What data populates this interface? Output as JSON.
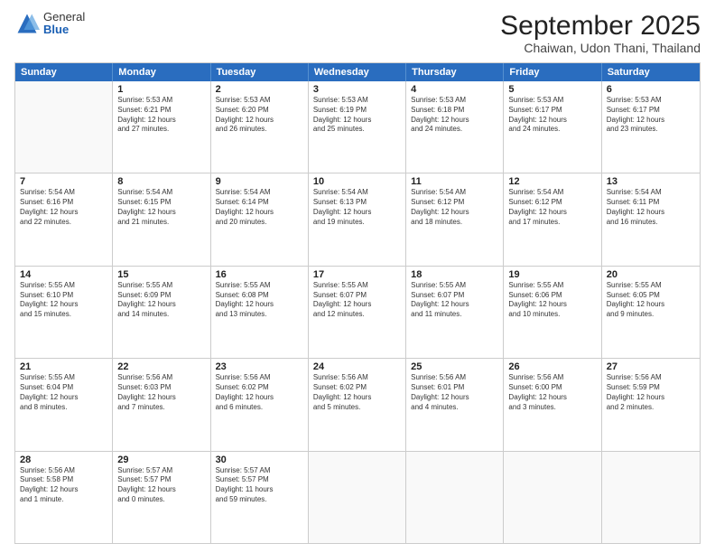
{
  "header": {
    "logo": {
      "general": "General",
      "blue": "Blue"
    },
    "title": "September 2025",
    "location": "Chaiwan, Udon Thani, Thailand"
  },
  "days_of_week": [
    "Sunday",
    "Monday",
    "Tuesday",
    "Wednesday",
    "Thursday",
    "Friday",
    "Saturday"
  ],
  "weeks": [
    [
      {
        "day": "",
        "info": ""
      },
      {
        "day": "1",
        "info": "Sunrise: 5:53 AM\nSunset: 6:21 PM\nDaylight: 12 hours\nand 27 minutes."
      },
      {
        "day": "2",
        "info": "Sunrise: 5:53 AM\nSunset: 6:20 PM\nDaylight: 12 hours\nand 26 minutes."
      },
      {
        "day": "3",
        "info": "Sunrise: 5:53 AM\nSunset: 6:19 PM\nDaylight: 12 hours\nand 25 minutes."
      },
      {
        "day": "4",
        "info": "Sunrise: 5:53 AM\nSunset: 6:18 PM\nDaylight: 12 hours\nand 24 minutes."
      },
      {
        "day": "5",
        "info": "Sunrise: 5:53 AM\nSunset: 6:17 PM\nDaylight: 12 hours\nand 24 minutes."
      },
      {
        "day": "6",
        "info": "Sunrise: 5:53 AM\nSunset: 6:17 PM\nDaylight: 12 hours\nand 23 minutes."
      }
    ],
    [
      {
        "day": "7",
        "info": "Sunrise: 5:54 AM\nSunset: 6:16 PM\nDaylight: 12 hours\nand 22 minutes."
      },
      {
        "day": "8",
        "info": "Sunrise: 5:54 AM\nSunset: 6:15 PM\nDaylight: 12 hours\nand 21 minutes."
      },
      {
        "day": "9",
        "info": "Sunrise: 5:54 AM\nSunset: 6:14 PM\nDaylight: 12 hours\nand 20 minutes."
      },
      {
        "day": "10",
        "info": "Sunrise: 5:54 AM\nSunset: 6:13 PM\nDaylight: 12 hours\nand 19 minutes."
      },
      {
        "day": "11",
        "info": "Sunrise: 5:54 AM\nSunset: 6:12 PM\nDaylight: 12 hours\nand 18 minutes."
      },
      {
        "day": "12",
        "info": "Sunrise: 5:54 AM\nSunset: 6:12 PM\nDaylight: 12 hours\nand 17 minutes."
      },
      {
        "day": "13",
        "info": "Sunrise: 5:54 AM\nSunset: 6:11 PM\nDaylight: 12 hours\nand 16 minutes."
      }
    ],
    [
      {
        "day": "14",
        "info": "Sunrise: 5:55 AM\nSunset: 6:10 PM\nDaylight: 12 hours\nand 15 minutes."
      },
      {
        "day": "15",
        "info": "Sunrise: 5:55 AM\nSunset: 6:09 PM\nDaylight: 12 hours\nand 14 minutes."
      },
      {
        "day": "16",
        "info": "Sunrise: 5:55 AM\nSunset: 6:08 PM\nDaylight: 12 hours\nand 13 minutes."
      },
      {
        "day": "17",
        "info": "Sunrise: 5:55 AM\nSunset: 6:07 PM\nDaylight: 12 hours\nand 12 minutes."
      },
      {
        "day": "18",
        "info": "Sunrise: 5:55 AM\nSunset: 6:07 PM\nDaylight: 12 hours\nand 11 minutes."
      },
      {
        "day": "19",
        "info": "Sunrise: 5:55 AM\nSunset: 6:06 PM\nDaylight: 12 hours\nand 10 minutes."
      },
      {
        "day": "20",
        "info": "Sunrise: 5:55 AM\nSunset: 6:05 PM\nDaylight: 12 hours\nand 9 minutes."
      }
    ],
    [
      {
        "day": "21",
        "info": "Sunrise: 5:55 AM\nSunset: 6:04 PM\nDaylight: 12 hours\nand 8 minutes."
      },
      {
        "day": "22",
        "info": "Sunrise: 5:56 AM\nSunset: 6:03 PM\nDaylight: 12 hours\nand 7 minutes."
      },
      {
        "day": "23",
        "info": "Sunrise: 5:56 AM\nSunset: 6:02 PM\nDaylight: 12 hours\nand 6 minutes."
      },
      {
        "day": "24",
        "info": "Sunrise: 5:56 AM\nSunset: 6:02 PM\nDaylight: 12 hours\nand 5 minutes."
      },
      {
        "day": "25",
        "info": "Sunrise: 5:56 AM\nSunset: 6:01 PM\nDaylight: 12 hours\nand 4 minutes."
      },
      {
        "day": "26",
        "info": "Sunrise: 5:56 AM\nSunset: 6:00 PM\nDaylight: 12 hours\nand 3 minutes."
      },
      {
        "day": "27",
        "info": "Sunrise: 5:56 AM\nSunset: 5:59 PM\nDaylight: 12 hours\nand 2 minutes."
      }
    ],
    [
      {
        "day": "28",
        "info": "Sunrise: 5:56 AM\nSunset: 5:58 PM\nDaylight: 12 hours\nand 1 minute."
      },
      {
        "day": "29",
        "info": "Sunrise: 5:57 AM\nSunset: 5:57 PM\nDaylight: 12 hours\nand 0 minutes."
      },
      {
        "day": "30",
        "info": "Sunrise: 5:57 AM\nSunset: 5:57 PM\nDaylight: 11 hours\nand 59 minutes."
      },
      {
        "day": "",
        "info": ""
      },
      {
        "day": "",
        "info": ""
      },
      {
        "day": "",
        "info": ""
      },
      {
        "day": "",
        "info": ""
      }
    ]
  ]
}
